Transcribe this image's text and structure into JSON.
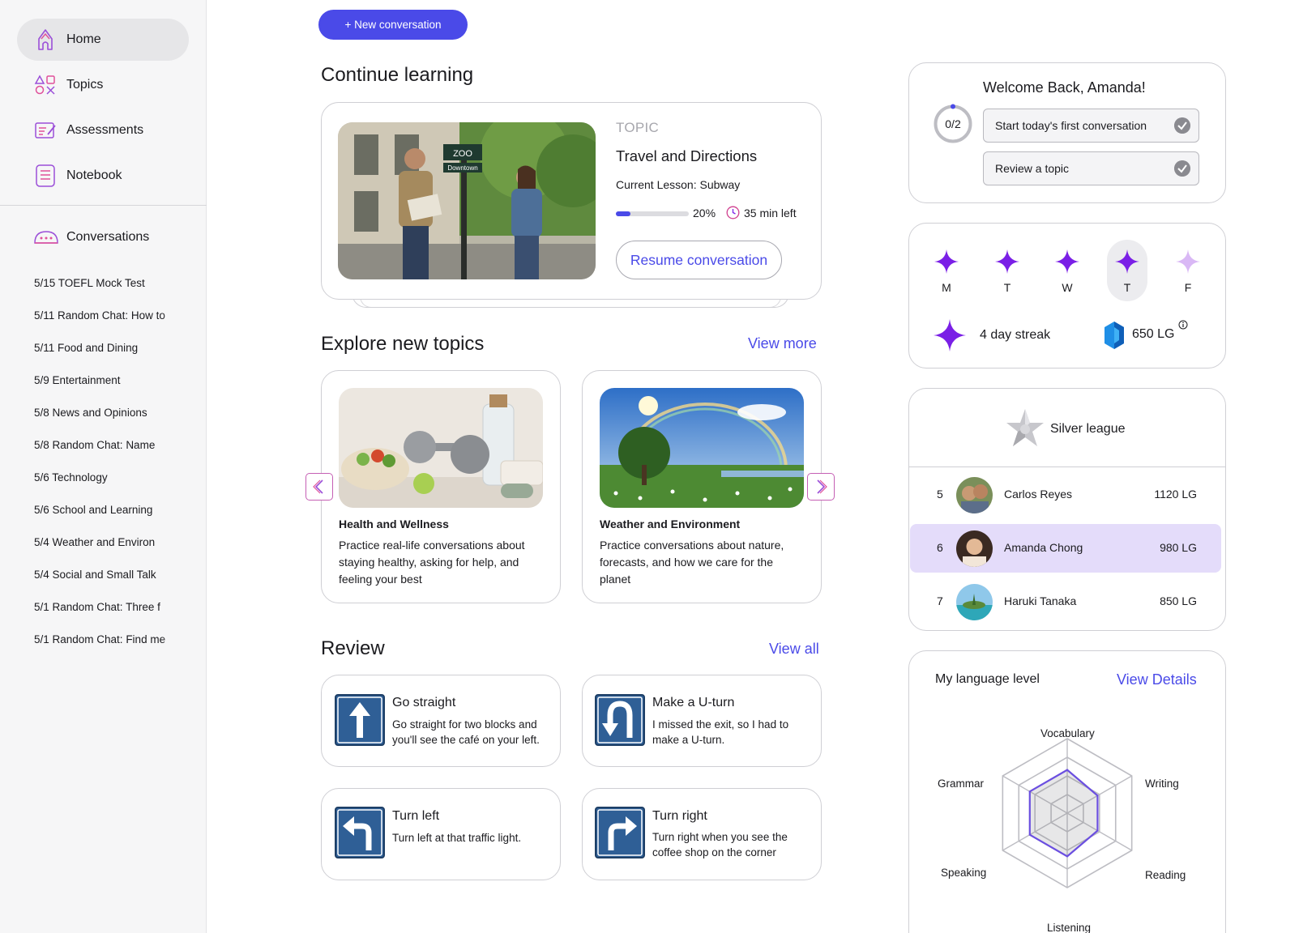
{
  "sidebar": {
    "nav": [
      {
        "label": "Home",
        "icon": "home-icon",
        "active": true
      },
      {
        "label": "Topics",
        "icon": "topics-icon"
      },
      {
        "label": "Assessments",
        "icon": "assessments-icon"
      },
      {
        "label": "Notebook",
        "icon": "notebook-icon"
      }
    ],
    "conversations_label": "Conversations",
    "conversations": [
      "5/15 TOEFL Mock Test",
      "5/11 Random Chat: How to",
      "5/11 Food and Dining",
      "5/9 Entertainment",
      "5/8 News and Opinions",
      "5/8 Random Chat: Name",
      "5/6 Technology",
      "5/6 School and Learning",
      "5/4 Weather and Environ",
      "5/4 Social and Small Talk",
      "5/1 Random Chat: Three f",
      "5/1 Random Chat: Find me"
    ]
  },
  "main": {
    "new_conversation": "+ New conversation",
    "continue": {
      "title": "Continue learning",
      "kicker": "TOPIC",
      "topic": "Travel and Directions",
      "lesson": "Current Lesson: Subway",
      "progress": 0.2,
      "progress_label": "20%",
      "time_left": "35 min left",
      "resume": "Resume conversation",
      "sign_top": "ZOO",
      "sign_bottom": "Downtown"
    },
    "explore": {
      "title": "Explore new topics",
      "view_more": "View more",
      "cards": [
        {
          "title": "Health and Wellness",
          "desc_lines": [
            "Practice real-life conversations about",
            "staying healthy, asking for help, and",
            "feeling your best"
          ]
        },
        {
          "title": "Weather and Environment",
          "desc_lines": [
            "Practice conversations about nature,",
            "forecasts, and how we care for the",
            "planet"
          ]
        }
      ]
    },
    "review": {
      "title": "Review",
      "view_all": "View all",
      "cards": [
        {
          "title": "Go straight",
          "icon": "arrow-up-sign-icon",
          "desc_lines": [
            "Go straight for two blocks and",
            "you'll see the café on your left."
          ]
        },
        {
          "title": "Make a U-turn",
          "icon": "u-turn-sign-icon",
          "desc_lines": [
            "I missed the exit, so I had to",
            "make a U-turn."
          ]
        },
        {
          "title": "Turn left",
          "icon": "turn-left-sign-icon",
          "desc_lines": [
            "Turn left at that traffic light."
          ]
        },
        {
          "title": "Turn right",
          "icon": "turn-right-sign-icon",
          "desc_lines": [
            "Turn right when you see the",
            "coffee shop on the corner"
          ]
        }
      ]
    }
  },
  "right": {
    "welcome": {
      "title": "Welcome Back, Amanda!",
      "progress_label": "0/2",
      "tasks": [
        "Start today's first conversation",
        "Review a topic"
      ]
    },
    "streak": {
      "days": [
        {
          "label": "M",
          "done": true
        },
        {
          "label": "T",
          "done": true
        },
        {
          "label": "W",
          "done": true
        },
        {
          "label": "T",
          "done": true,
          "today": true
        },
        {
          "label": "F",
          "done": false
        }
      ],
      "streak_label": "4 day streak",
      "lg_label": "650 LG",
      "info_icon": "info-icon"
    },
    "league": {
      "title": "Silver league",
      "rows": [
        {
          "rank": "5",
          "name": "Carlos Reyes",
          "score": "1120 LG"
        },
        {
          "rank": "6",
          "name": "Amanda Chong",
          "score": "980 LG",
          "me": true
        },
        {
          "rank": "7",
          "name": "Haruki Tanaka",
          "score": "850 LG"
        }
      ]
    },
    "level": {
      "title": "My language level",
      "view_details": "View Details",
      "axes": [
        "Vocabulary",
        "Writing",
        "Reading",
        "Listening",
        "Speaking",
        "Grammar"
      ],
      "values": [
        0.58,
        0.47,
        0.47,
        0.58,
        0.58,
        0.58
      ]
    }
  },
  "colors": {
    "accent": "#4a4ae8",
    "sparkle": "#7a1fe6",
    "sparkle_faded": "#d9b8f5",
    "highlight_row": "#e4dcfa",
    "sign_blue": "#2f5f96"
  }
}
